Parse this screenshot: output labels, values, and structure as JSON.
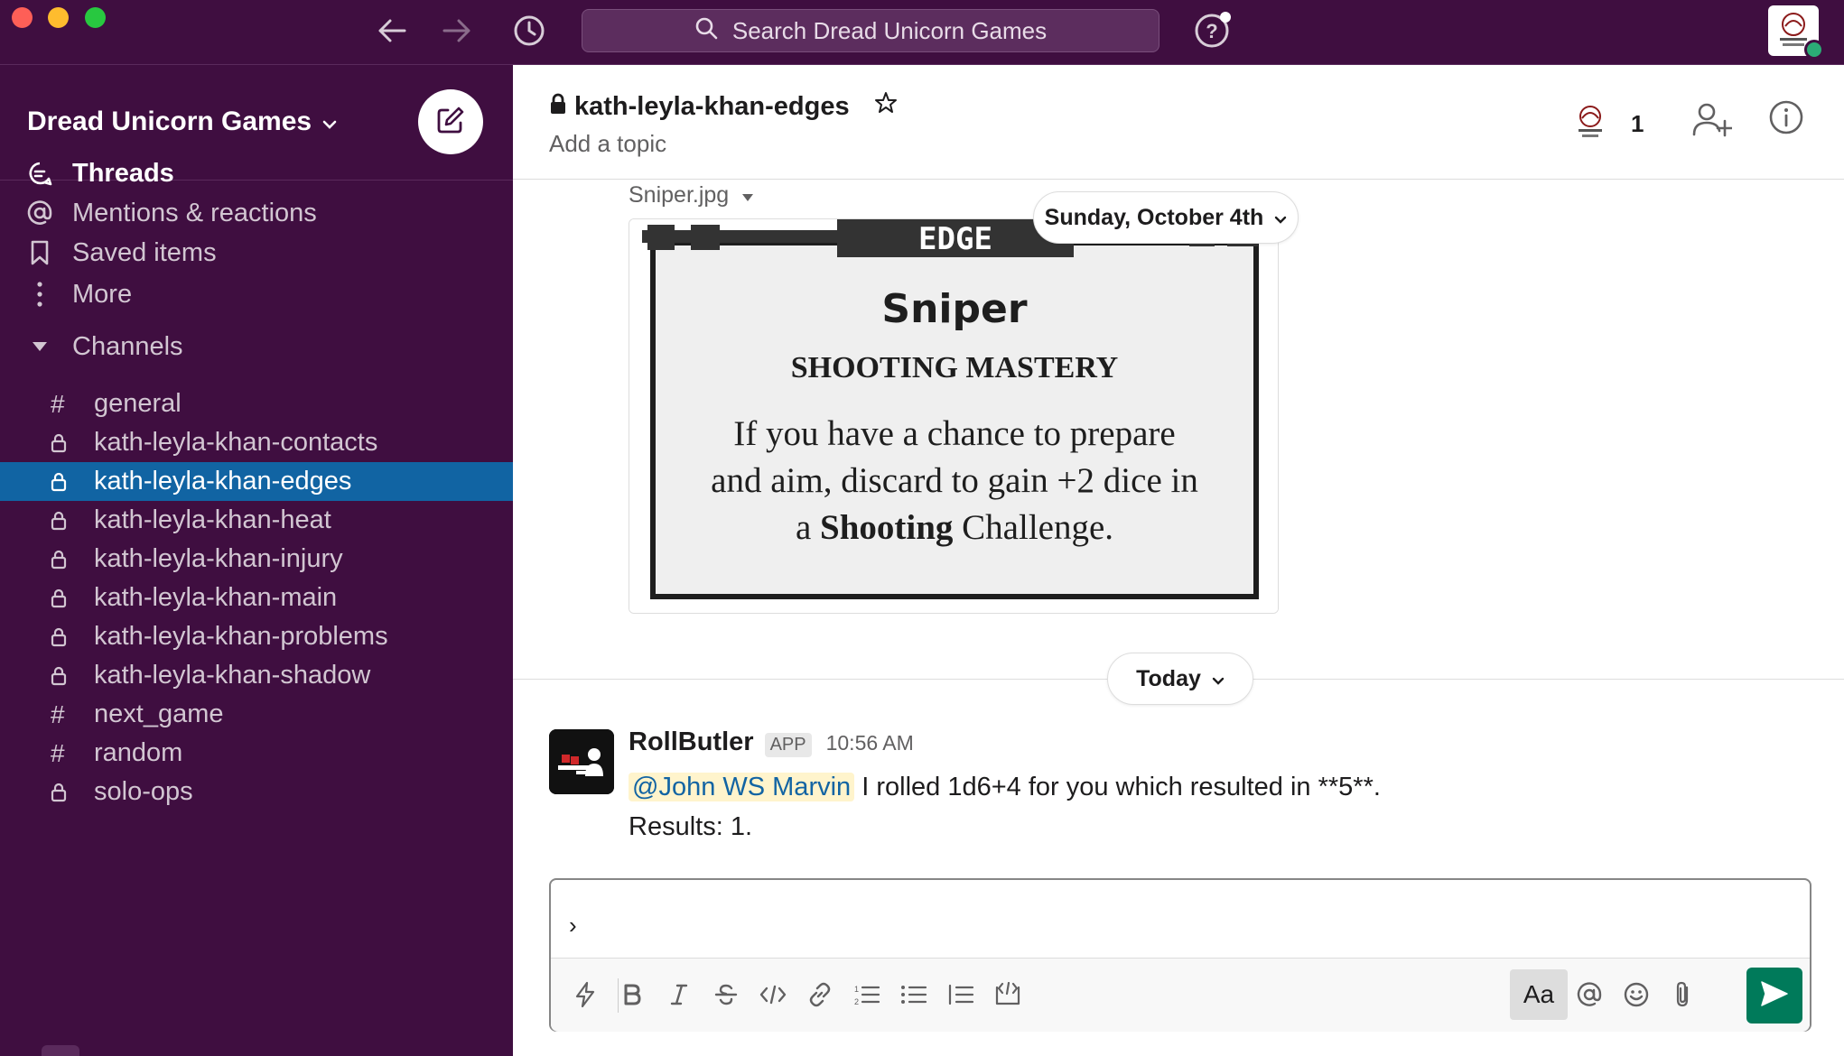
{
  "titlebar": {
    "search_placeholder": "Search Dread Unicorn Games"
  },
  "sidebar": {
    "workspace_name": "Dread Unicorn Games",
    "nav": [
      {
        "label": "Threads",
        "icon": "threads-icon"
      },
      {
        "label": "Mentions & reactions",
        "icon": "at-icon"
      },
      {
        "label": "Saved items",
        "icon": "bookmark-icon"
      },
      {
        "label": "More",
        "icon": "more-vertical-icon"
      }
    ],
    "channels_heading": "Channels",
    "channels": [
      {
        "name": "general",
        "type": "public",
        "symbol": "#"
      },
      {
        "name": "kath-leyla-khan-contacts",
        "type": "private"
      },
      {
        "name": "kath-leyla-khan-edges",
        "type": "private",
        "selected": true
      },
      {
        "name": "kath-leyla-khan-heat",
        "type": "private"
      },
      {
        "name": "kath-leyla-khan-injury",
        "type": "private"
      },
      {
        "name": "kath-leyla-khan-main",
        "type": "private"
      },
      {
        "name": "kath-leyla-khan-problems",
        "type": "private"
      },
      {
        "name": "kath-leyla-khan-shadow",
        "type": "private"
      },
      {
        "name": "next_game",
        "type": "public",
        "symbol": "#"
      },
      {
        "name": "random",
        "type": "public",
        "symbol": "#"
      },
      {
        "name": "solo-ops",
        "type": "private"
      }
    ]
  },
  "channel": {
    "name": "kath-leyla-khan-edges",
    "topic": "Add a topic",
    "member_count": "1"
  },
  "attachment": {
    "file_name": "Sniper.jpg",
    "card": {
      "banner": "EDGE",
      "title": "Sniper",
      "subtitle": "SHOOTING MASTERY",
      "line1": "If you have a chance to prepare",
      "line2": "and aim, discard to gain +2 dice in",
      "line3_prefix": "a ",
      "line3_bold": "Shooting",
      "line3_suffix": " Challenge."
    }
  },
  "date_pills": {
    "previous": "Sunday, October 4th",
    "today": "Today"
  },
  "message": {
    "author": "RollButler",
    "badge": "APP",
    "time": "10:56 AM",
    "mention": "@John WS Marvin",
    "text": " I rolled 1d6+4 for you which resulted in **5**.",
    "results": "Results: 1."
  },
  "composer": {
    "value": "›",
    "aa_label": "Aa"
  },
  "colors": {
    "sidebar_bg": "#3f0e40",
    "selected_channel": "#1164a3",
    "send_button": "#007a5a",
    "mention_bg": "#fff4cc",
    "mention_text": "#1264a3",
    "presence": "#2bac76"
  }
}
